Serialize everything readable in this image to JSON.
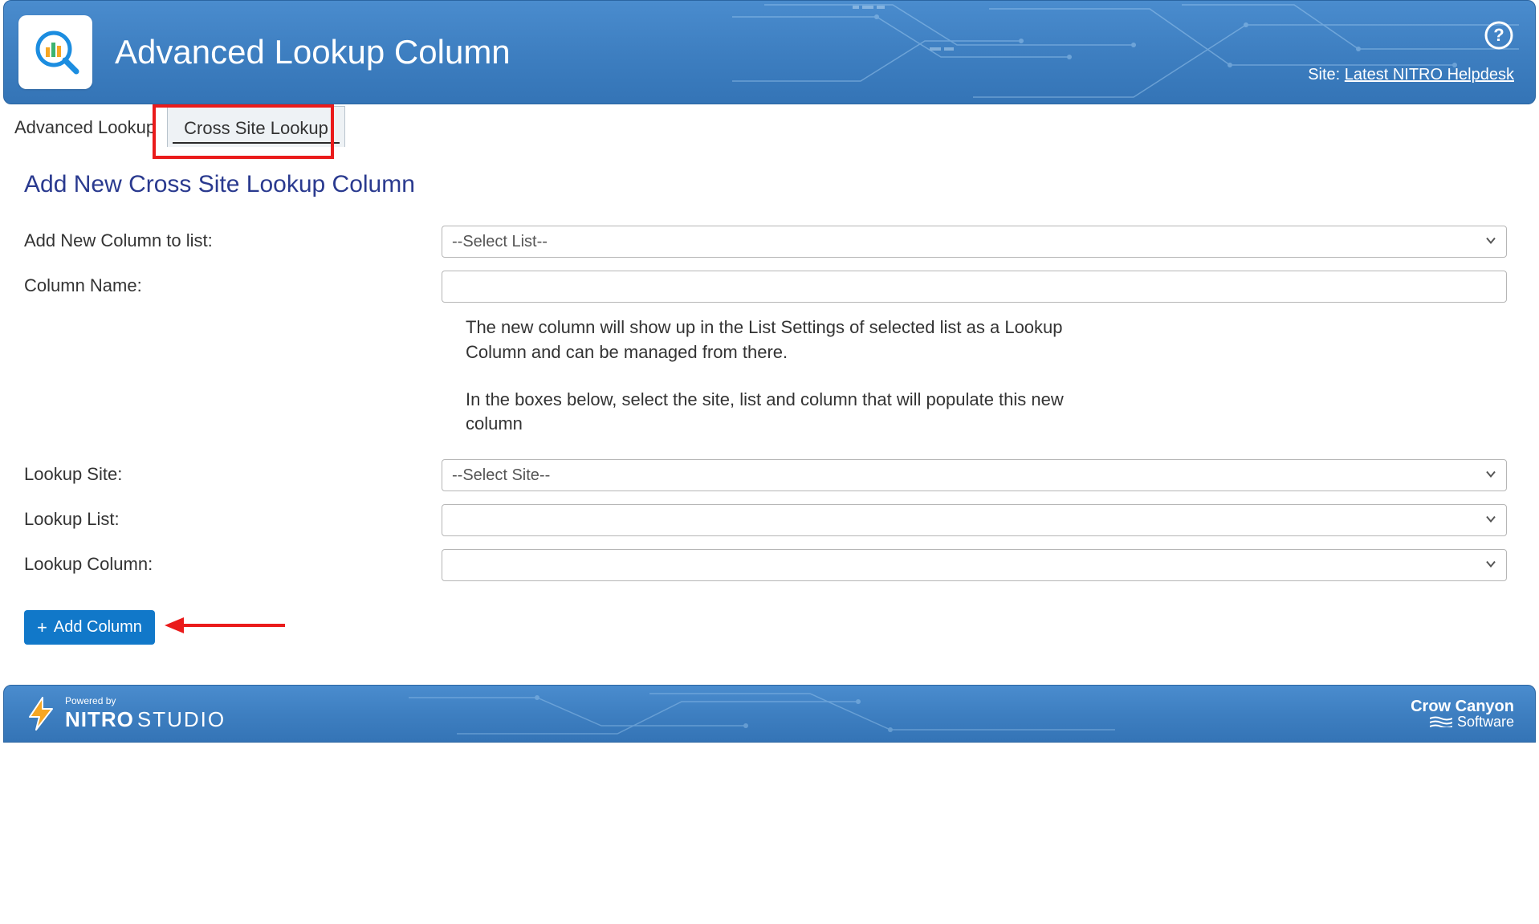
{
  "header": {
    "title": "Advanced Lookup Column",
    "site_prefix": "Site:",
    "site_link": "Latest NITRO Helpdesk"
  },
  "tabs": {
    "advanced_lookup": "Advanced Lookup",
    "cross_site_lookup": "Cross Site Lookup"
  },
  "section": {
    "title": "Add New Cross Site Lookup Column"
  },
  "form": {
    "add_to_list_label": "Add New Column to list:",
    "add_to_list_value": "--Select List--",
    "column_name_label": "Column Name:",
    "column_name_value": "",
    "helper1": "The new column will show up in the List Settings of selected list as a Lookup Column and can be managed from there.",
    "helper2": "In the boxes below, select the site, list and column that will populate this new column",
    "lookup_site_label": "Lookup Site:",
    "lookup_site_value": "--Select Site--",
    "lookup_list_label": "Lookup List:",
    "lookup_list_value": "",
    "lookup_column_label": "Lookup Column:",
    "lookup_column_value": ""
  },
  "buttons": {
    "add_column": "Add Column"
  },
  "footer": {
    "powered": "Powered by",
    "nitro": "NITRO",
    "studio": "STUDIO",
    "cc_top": "Crow Canyon",
    "cc_bot": "Software"
  }
}
